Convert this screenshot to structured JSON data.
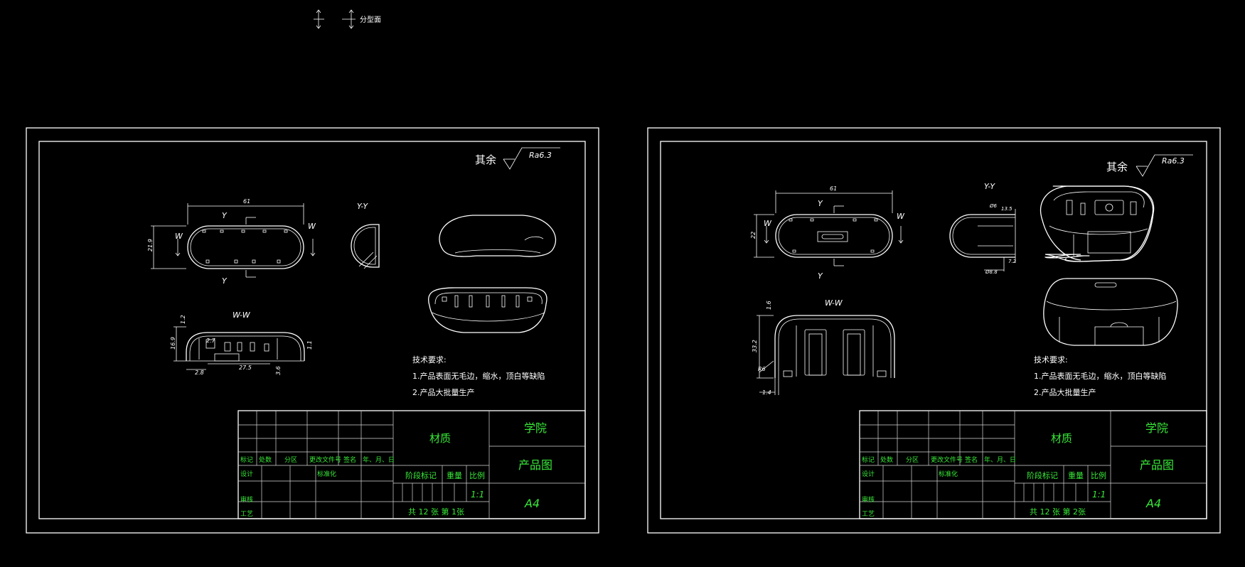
{
  "legend": {
    "parting_line": "分型面"
  },
  "sheets": [
    {
      "roughness_prefix": "其余",
      "roughness_value": "Ra6.3",
      "section_labels": {
        "yy": "Y-Y",
        "ww": "W-W",
        "y_top": "Y",
        "y_bottom": "Y",
        "w_left": "W",
        "w_right": "W"
      },
      "dims": {
        "length": "61",
        "width": "21.9",
        "ww_height": "16.9",
        "ww_top": "1.2",
        "ww_side": "1.1",
        "ww_a": "2.7",
        "ww_b": "27.5",
        "ww_c": "2.8",
        "ww_d": "3.6"
      },
      "tech_title": "技术要求:",
      "tech_1": "1.产品表面无毛边，缩水，顶白等缺陷",
      "tech_2": "2.产品大批量生产",
      "tb": {
        "h_mark": "标记",
        "h_count": "处数",
        "h_zone": "分区",
        "h_doc": "更改文件号",
        "h_sign": "签名",
        "h_date": "年、月、日",
        "design": "设计",
        "standard": "标准化",
        "review": "审核",
        "process": "工艺",
        "material": "材质",
        "school": "学院",
        "drawing": "产品图",
        "stage": "阶段标记",
        "weight": "重量",
        "scale_label": "比例",
        "scale": "1:1",
        "sheets": "共 12 张 第 1张",
        "format": "A4"
      }
    },
    {
      "roughness_prefix": "其余",
      "roughness_value": "Ra6.3",
      "section_labels": {
        "yy": "Y-Y",
        "ww": "W-W",
        "y_top": "Y",
        "y_bottom": "Y",
        "w_left": "W",
        "w_right": "W"
      },
      "dims": {
        "length": "61",
        "width": "22",
        "ww_height": "33.2",
        "ww_top": "1.6",
        "ww_left": "1.4",
        "yy_a": "Ø6",
        "yy_b": "13.5",
        "yy_c": "Ø8.8",
        "yy_d": "7.2",
        "ww_r": "R6"
      },
      "tech_title": "技术要求:",
      "tech_1": "1.产品表面无毛边，缩水，顶白等缺陷",
      "tech_2": "2.产品大批量生产",
      "tb": {
        "h_mark": "标记",
        "h_count": "处数",
        "h_zone": "分区",
        "h_doc": "更改文件号",
        "h_sign": "签名",
        "h_date": "年、月、日",
        "design": "设计",
        "standard": "标准化",
        "review": "审核",
        "process": "工艺",
        "material": "材质",
        "school": "学院",
        "drawing": "产品图",
        "stage": "阶段标记",
        "weight": "重量",
        "scale_label": "比例",
        "scale": "1:1",
        "sheets": "共 12 张 第 2张",
        "format": "A4"
      }
    }
  ],
  "colors": {
    "background": "#000000",
    "lines": "#ffffff",
    "title_text": "#38e838"
  }
}
